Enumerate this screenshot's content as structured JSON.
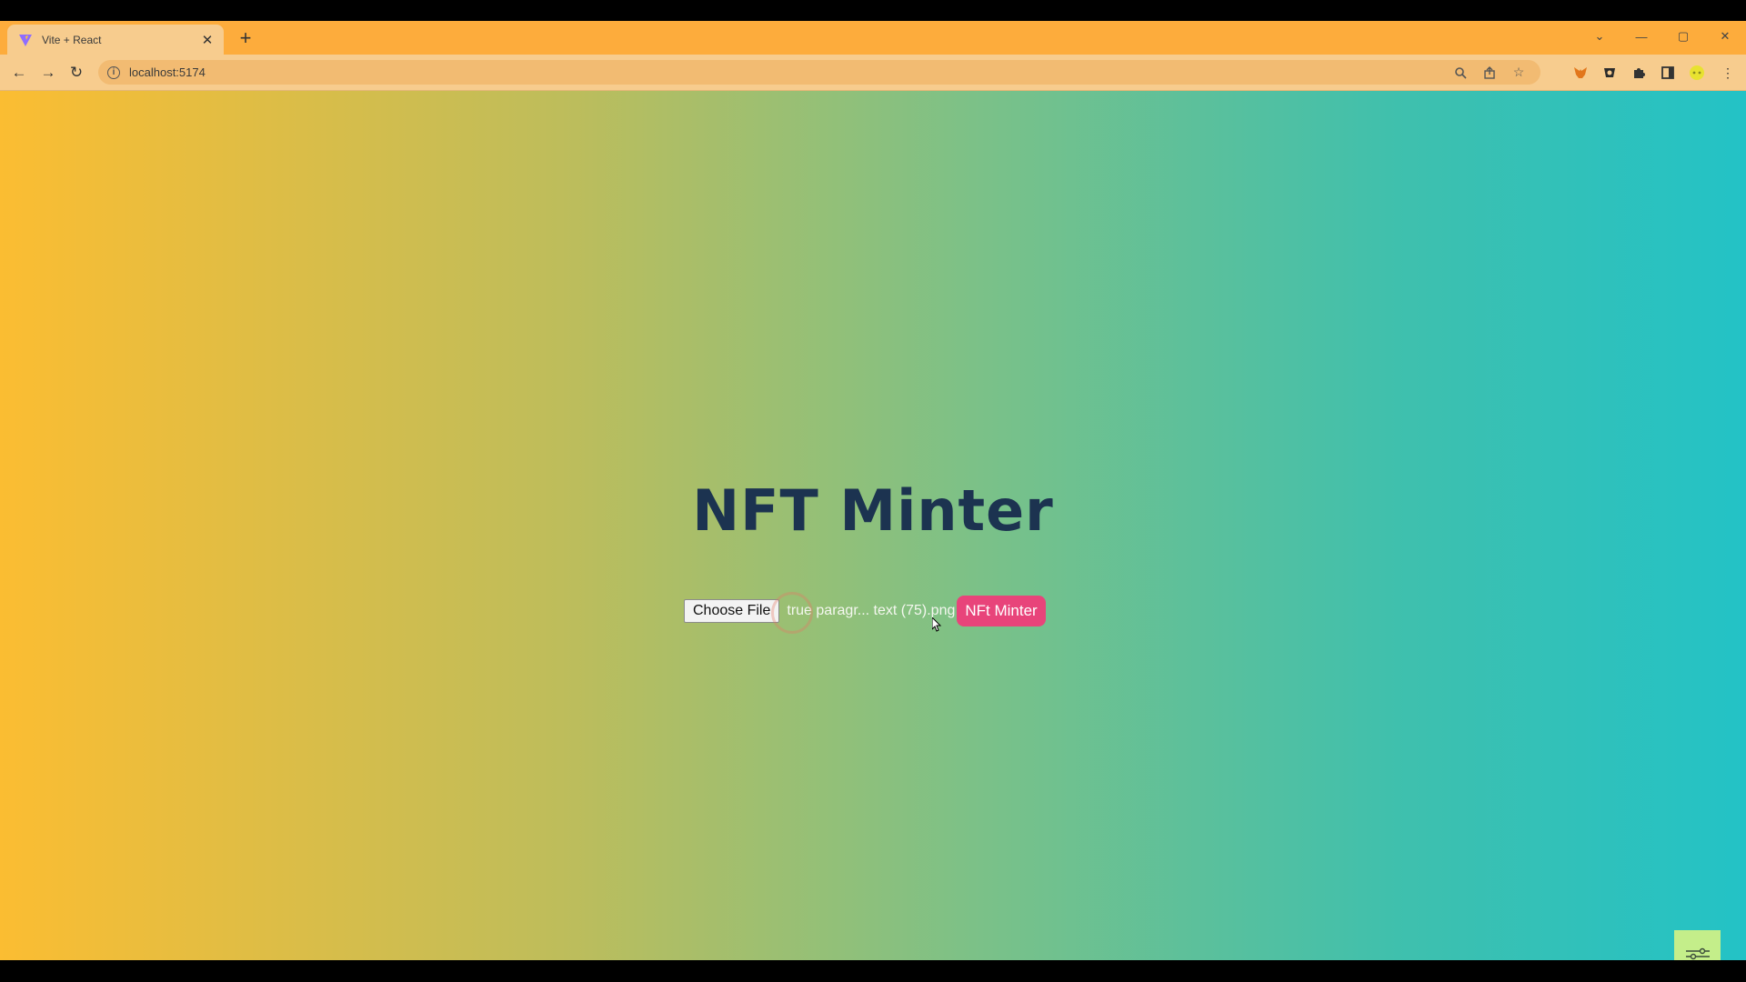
{
  "tab": {
    "title": "Vite + React",
    "close": "✕",
    "new_tab": "+"
  },
  "window_controls": {
    "dropdown": "⌄",
    "minimize": "—",
    "maximize": "▢",
    "close": "✕"
  },
  "toolbar": {
    "back": "←",
    "forward": "→",
    "reload": "↻",
    "url": "localhost:5174"
  },
  "page": {
    "title": "NFT Minter",
    "choose_file_label": "Choose File",
    "file_name": "true paragr... text (75).png",
    "mint_button_label": "NFt Minter"
  },
  "colors": {
    "tabstrip": "#fdac3c",
    "toolbar": "#f7cc8e",
    "gradient_left": "#fbbd32",
    "gradient_right": "#23c2c6",
    "title": "#1c3350",
    "mint_button": "#e8447a"
  },
  "icons": {
    "favicon": "vite-logo-icon",
    "info": "info-icon",
    "zoom": "zoom-icon",
    "share": "share-icon",
    "bookmark": "star-icon",
    "metamask": "metamask-fox-icon",
    "extension": "extension-icon",
    "puzzle": "puzzle-icon",
    "sidepanel": "side-panel-icon",
    "profile": "profile-icon",
    "menu": "kebab-menu-icon",
    "corner": "settings-sliders-icon"
  }
}
